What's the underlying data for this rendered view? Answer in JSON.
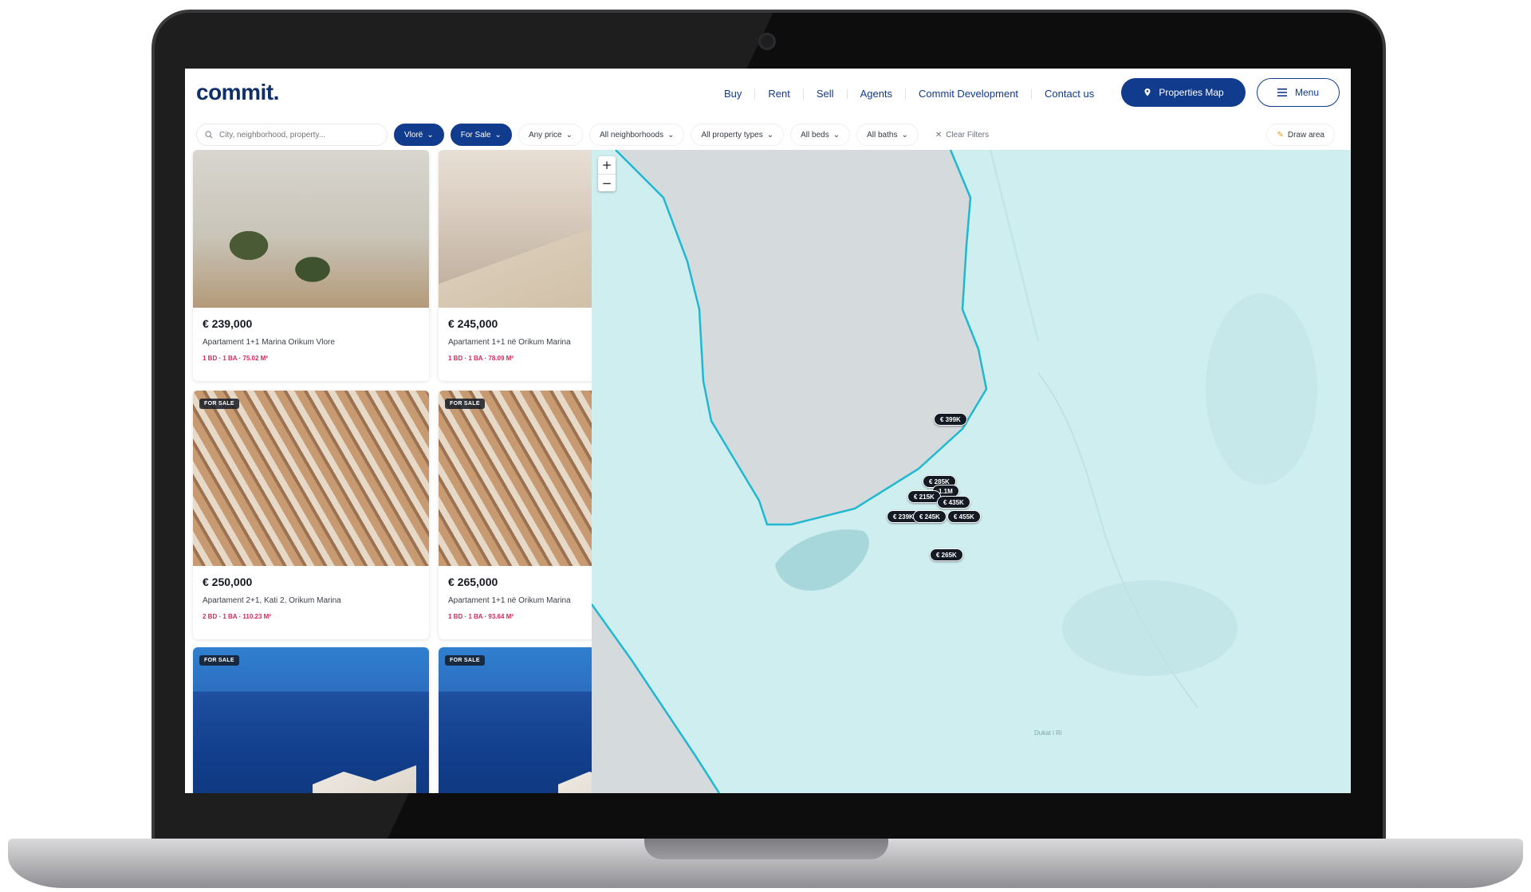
{
  "brand": {
    "logo": "commit.",
    "accent": "#113b8c",
    "price_spec_color": "#d6285c"
  },
  "nav": {
    "items": [
      {
        "label": "Buy"
      },
      {
        "label": "Rent"
      },
      {
        "label": "Sell"
      },
      {
        "label": "Agents"
      },
      {
        "label": "Commit Development"
      },
      {
        "label": "Contact us"
      }
    ],
    "properties_map_label": "Properties Map",
    "properties_map_icon": "map-pin-icon",
    "menu_label": "Menu",
    "menu_icon": "hamburger-icon"
  },
  "filters": {
    "search_placeholder": "City, neighborhood, property...",
    "city": "Vlorë",
    "status": "For Sale",
    "price": "Any price",
    "neighborhoods": "All neighborhoods",
    "property_types": "All property types",
    "beds": "All beds",
    "baths": "All baths",
    "clear": "Clear Filters",
    "draw_area": "Draw area"
  },
  "listings": [
    {
      "price": "€ 239,000",
      "title": "Apartament 1+1 Marina Orikum Vlore",
      "specs": "1 BD · 1 BA · 75.02 M²",
      "badge": ""
    },
    {
      "price": "€ 245,000",
      "title": "Apartament 1+1 në Orikum Marina",
      "specs": "1 BD · 1 BA · 78.09 M²",
      "badge": ""
    },
    {
      "price": "€ 250,000",
      "title": "Apartament 2+1, Kati 2, Orikum Marina",
      "specs": "2 BD · 1 BA · 110.23 M²",
      "badge": "FOR SALE"
    },
    {
      "price": "€ 265,000",
      "title": "Apartament 1+1 në Orikum Marina",
      "specs": "1 BD · 1 BA · 93.64 M²",
      "badge": "FOR SALE"
    },
    {
      "price": "",
      "title": "",
      "specs": "",
      "badge": "FOR SALE"
    },
    {
      "price": "",
      "title": "",
      "specs": "",
      "badge": "FOR SALE"
    }
  ],
  "map": {
    "zoom_in": "+",
    "zoom_out": "−",
    "place_label": "Dukat i Ri",
    "markers": [
      "€ 399K",
      "€ 285K",
      "1.1M",
      "€ 215K",
      "€ 435K",
      "€ 239K",
      "€ 245K",
      "€ 455K",
      "€ 265K"
    ]
  }
}
